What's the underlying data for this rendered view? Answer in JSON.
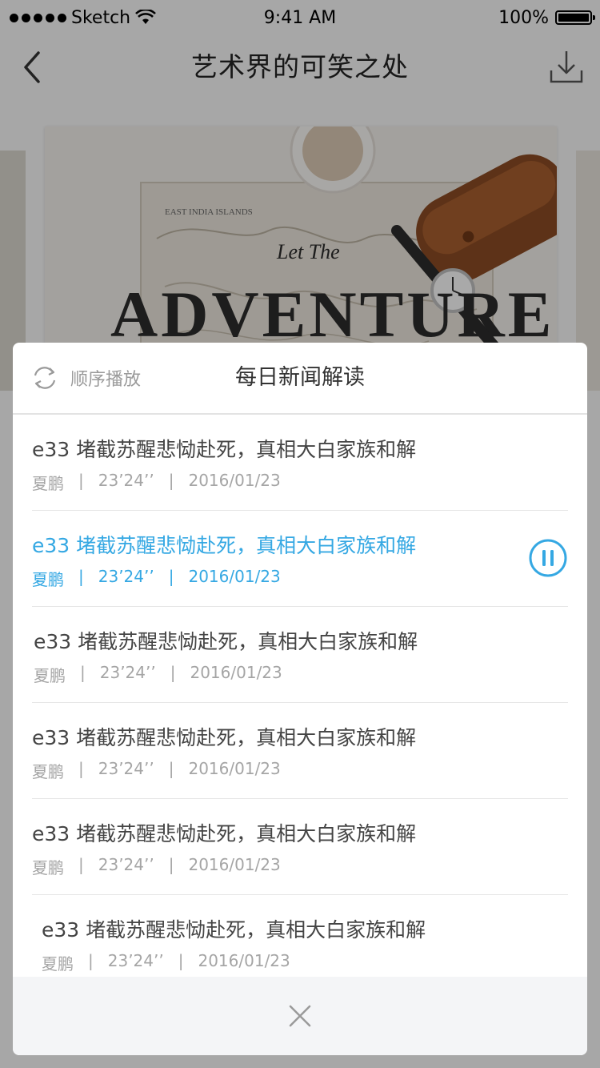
{
  "status_bar": {
    "carrier": "Sketch",
    "time": "9:41 AM",
    "battery": "100%"
  },
  "nav": {
    "title": "艺术界的可笑之处",
    "back_icon": "chevron-left-icon",
    "download_icon": "download-icon"
  },
  "cover": {
    "text_small": "Let The",
    "text_large": "ADVENTURE",
    "map_label": "EAST INDIA ISLANDS"
  },
  "playlist": {
    "mode_label": "顺序播放",
    "mode_icon": "repeat-icon",
    "title": "每日新闻解读",
    "items": [
      {
        "title": "e33 堵截苏醒悲恸赴死，真相大白家族和解",
        "author": "夏鹏",
        "duration": "23’24’’",
        "date": "2016/01/23",
        "active": false
      },
      {
        "title": "e33 堵截苏醒悲恸赴死，真相大白家族和解",
        "author": "夏鹏",
        "duration": "23’24’’",
        "date": "2016/01/23",
        "active": true
      },
      {
        "title": "e33 堵截苏醒悲恸赴死，真相大白家族和解",
        "author": "夏鹏",
        "duration": "23’24’’",
        "date": "2016/01/23",
        "active": false
      },
      {
        "title": "e33 堵截苏醒悲恸赴死，真相大白家族和解",
        "author": "夏鹏",
        "duration": "23’24’’",
        "date": "2016/01/23",
        "active": false
      },
      {
        "title": "e33 堵截苏醒悲恸赴死，真相大白家族和解",
        "author": "夏鹏",
        "duration": "23’24’’",
        "date": "2016/01/23",
        "active": false
      },
      {
        "title": "e33 堵截苏醒悲恸赴死，真相大白家族和解",
        "author": "夏鹏",
        "duration": "23’24’’",
        "date": "2016/01/23",
        "active": false
      }
    ],
    "separator": "|",
    "close_icon": "close-icon"
  },
  "colors": {
    "accent": "#35a8e3",
    "text_primary": "#444444",
    "text_secondary": "#a5a5a5"
  }
}
